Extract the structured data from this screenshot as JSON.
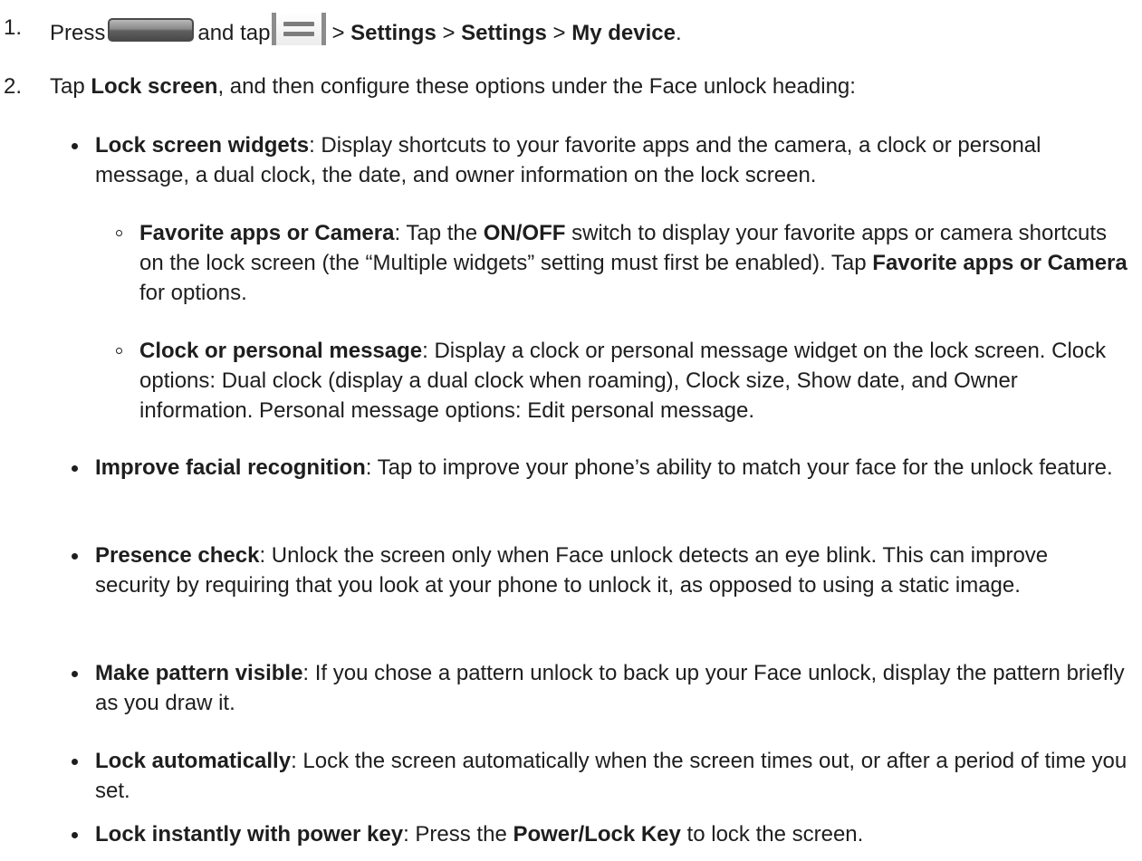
{
  "steps": [
    {
      "num": "1.",
      "t1": "Press",
      "t2": "and tap",
      "t3": ">",
      "b1": "Settings",
      "t4": ">",
      "b2": "Settings",
      "t5": ">",
      "b3": "My device",
      "t6": "."
    },
    {
      "num": "2.",
      "t1": "Tap",
      "b1": "Lock screen",
      "t2": ", and then configure these options under the Face unlock heading:"
    }
  ],
  "icons": {
    "home_key": "home-key-icon",
    "menu_key": "menu-key-icon"
  },
  "bullets": [
    {
      "title": "Lock screen widgets",
      "text": ": Display shortcuts to your favorite apps and the camera, a clock or personal message, a dual clock, the date, and owner information on the lock screen."
    },
    {
      "title": "Improve facial recognition",
      "text": ": Tap to improve your phone’s ability to match your face for the unlock feature."
    },
    {
      "title": "Presence check",
      "text": ": Unlock the screen only when Face unlock detects an eye blink. This can improve security by requiring that you look at your phone to unlock it, as opposed to using a static image."
    },
    {
      "title": "Make pattern visible",
      "text": ": If you chose a pattern unlock to back up your Face unlock, display the pattern briefly as you draw it."
    },
    {
      "title": "Lock automatically",
      "text": ": Lock the screen automatically when the screen times out, or after a period of time you set."
    },
    {
      "title": "Lock instantly with power key",
      "t1": ": Press the",
      "b1": "Power/Lock Key",
      "t2": "to lock the screen."
    }
  ],
  "subbullets": [
    {
      "title": "Favorite apps or Camera",
      "t1": ": Tap the",
      "b1": "ON/OFF",
      "t2": "switch to display your favorite apps or camera shortcuts on the lock screen (the “Multiple widgets” setting must first be enabled). Tap",
      "b2": "Favorite apps or Camera",
      "t3": "for options."
    },
    {
      "title": "Clock or personal message",
      "text": ": Display a clock or personal message widget on the lock screen. Clock options: Dual clock (display a dual clock when roaming), Clock size, Show date, and Owner information. Personal message options: Edit personal message."
    }
  ]
}
